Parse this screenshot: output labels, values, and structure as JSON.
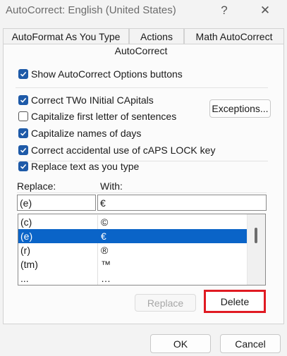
{
  "window": {
    "title": "AutoCorrect: English (United States)",
    "help_glyph": "?",
    "close_glyph": "✕"
  },
  "tabs": [
    {
      "label": "AutoFormat As You Type"
    },
    {
      "label": "Actions"
    },
    {
      "label": "Math AutoCorrect"
    }
  ],
  "active_tab": {
    "label": "AutoCorrect"
  },
  "options": {
    "show_buttons": {
      "label": "Show AutoCorrect Options buttons",
      "checked": true
    },
    "two_initial_caps": {
      "label": "Correct TWo INitial CApitals",
      "checked": true
    },
    "capitalize_first": {
      "label": "Capitalize first letter of sentences",
      "checked": false
    },
    "capitalize_days": {
      "label": "Capitalize names of days",
      "checked": true
    },
    "caps_lock": {
      "label": "Correct accidental use of cAPS LOCK key",
      "checked": true
    },
    "replace_text": {
      "label": "Replace text as you type",
      "checked": true
    }
  },
  "exceptions_button": "Exceptions...",
  "replace_label": "Replace:",
  "with_label": "With:",
  "replace_value": "(e)",
  "with_value": "€",
  "entries": [
    {
      "replace": "(c)",
      "with": "©"
    },
    {
      "replace": "(e)",
      "with": "€",
      "selected": true
    },
    {
      "replace": "(r)",
      "with": "®"
    },
    {
      "replace": "(tm)",
      "with": "™"
    },
    {
      "replace": "...",
      "with": "…"
    }
  ],
  "replace_button": "Replace",
  "delete_button": "Delete",
  "ok_button": "OK",
  "cancel_button": "Cancel",
  "colors": {
    "accent": "#1e5aa8",
    "selection": "#0a64c8",
    "highlight": "#e01a22"
  }
}
